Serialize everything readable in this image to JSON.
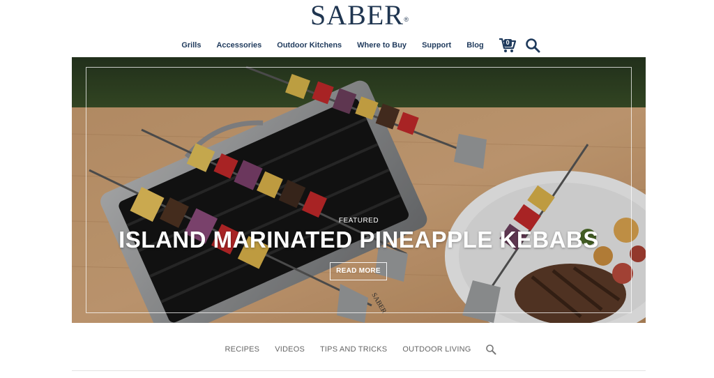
{
  "brand": {
    "logo_text": "SABER",
    "logo_mark": "®"
  },
  "top_nav": {
    "items": [
      "Grills",
      "Accessories",
      "Outdoor Kitchens",
      "Where to Buy",
      "Support",
      "Blog"
    ],
    "cart_count": "0"
  },
  "hero": {
    "eyebrow": "FEATURED",
    "title": "ISLAND MARINATED PINEAPPLE KEBABS",
    "button": "READ MORE",
    "skewer_brand": "SABER"
  },
  "sub_nav": {
    "items": [
      "RECIPES",
      "VIDEOS",
      "TIPS AND TRICKS",
      "OUTDOOR LIVING"
    ]
  },
  "colors": {
    "brand_navy": "#1f3a5c",
    "sub_nav_text": "#666666"
  },
  "icons": {
    "cart": "shopping-cart-icon",
    "search": "search-icon"
  }
}
